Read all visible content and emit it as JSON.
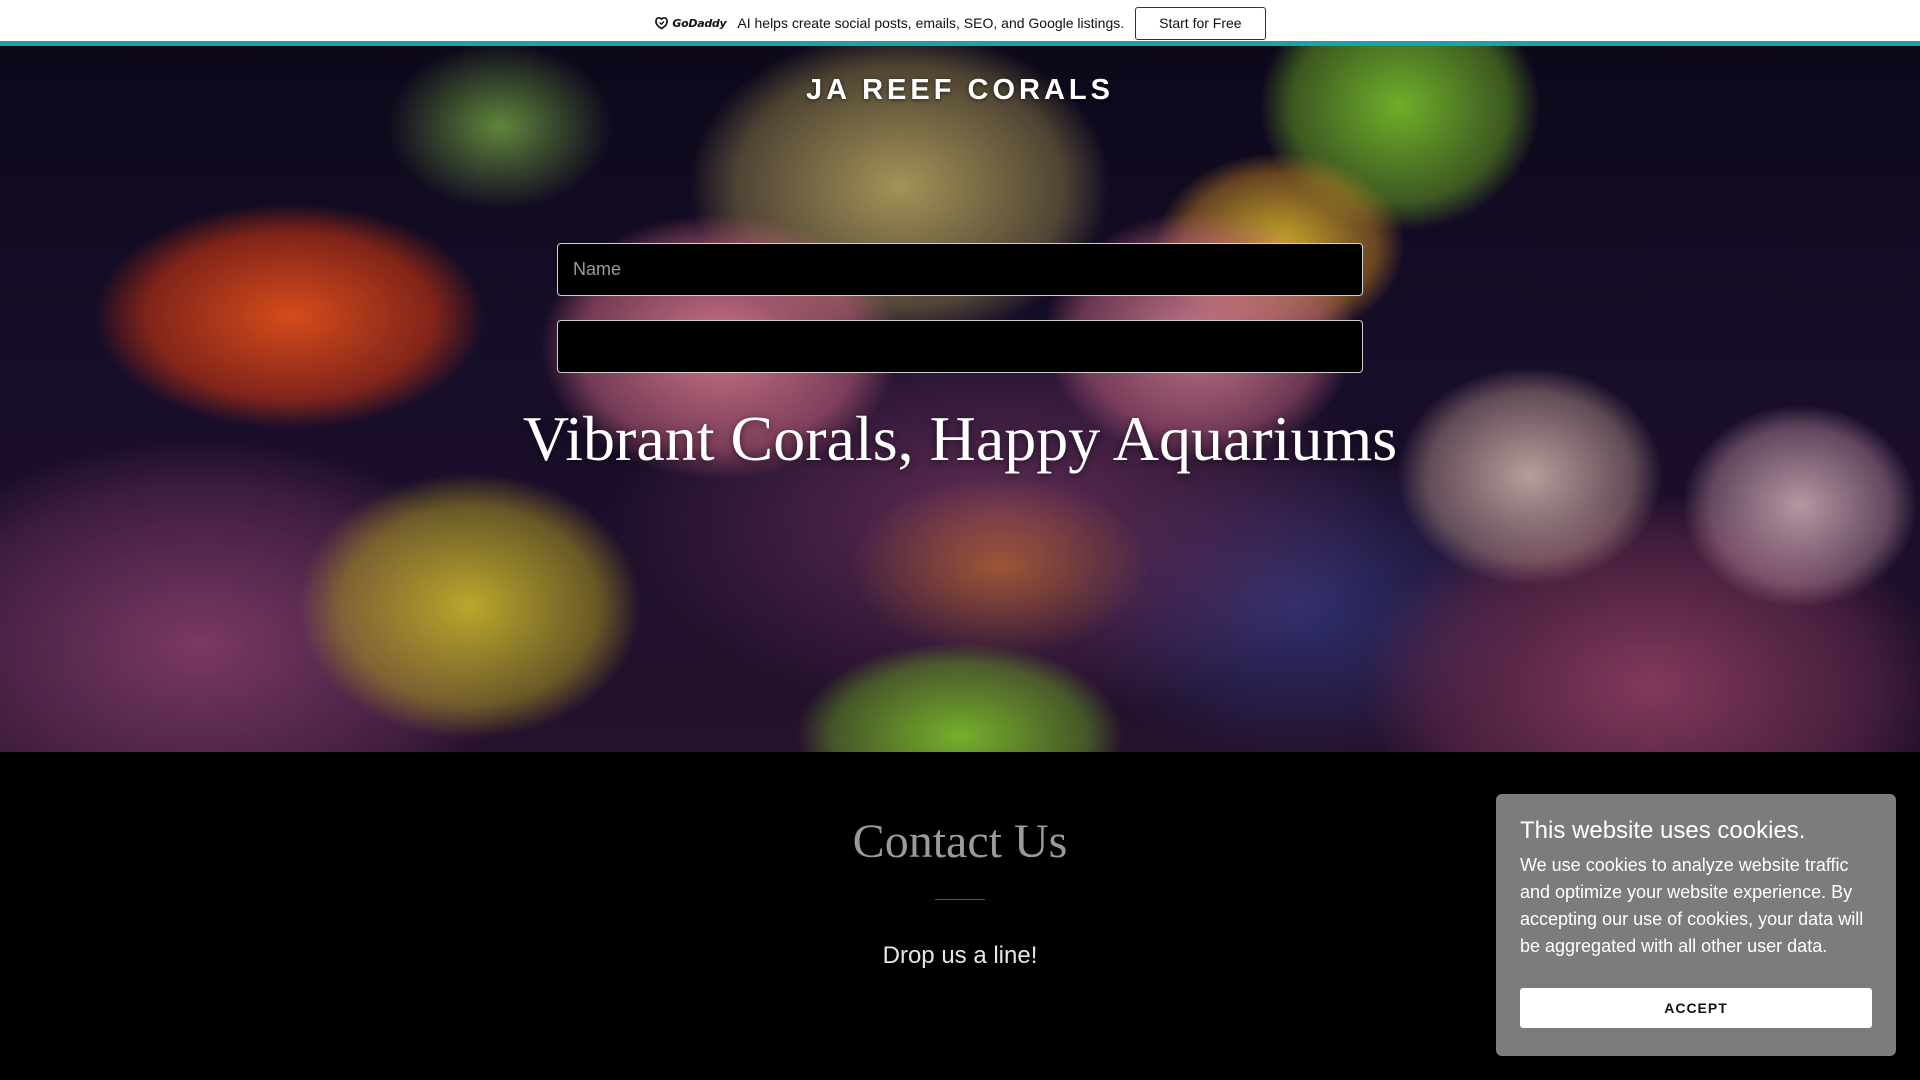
{
  "promo": {
    "logo_text": "GoDaddy",
    "logo_icon": "godaddy-logo-icon",
    "message": "AI helps create social posts, emails, SEO, and Google listings.",
    "cta_label": "Start for Free",
    "accent_color": "#19a3a8"
  },
  "hero": {
    "site_title": "JA REEF CORALS",
    "tagline": "Vibrant Corals, Happy Aquariums",
    "image": "coral-reef-aquarium-photo"
  },
  "contact": {
    "title": "Contact Us",
    "subtitle": "Drop us a line!",
    "name_placeholder": "Name",
    "email_placeholder": ""
  },
  "cookie": {
    "title": "This website uses cookies.",
    "body": "We use cookies to analyze website traffic and optimize your website experience. By accepting our use of cookies, your data will be aggregated with all other user data.",
    "accept_label": "ACCEPT"
  }
}
